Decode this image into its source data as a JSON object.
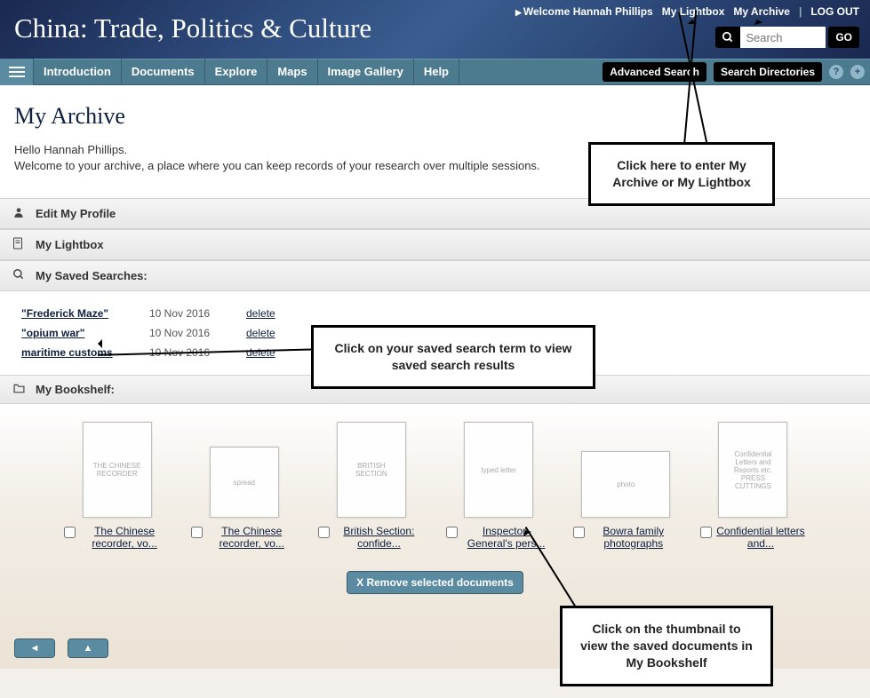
{
  "banner": {
    "title": "China: Trade, Politics & Culture",
    "welcome": "Welcome Hannah Phillips",
    "my_lightbox": "My Lightbox",
    "my_archive": "My Archive",
    "logout": "LOG OUT",
    "search_placeholder": "Search",
    "go": "GO"
  },
  "nav": {
    "items": [
      "Introduction",
      "Documents",
      "Explore",
      "Maps",
      "Image Gallery",
      "Help"
    ],
    "advanced": "Advanced Search",
    "directories": "Search Directories"
  },
  "page": {
    "title": "My Archive",
    "greeting": "Hello Hannah Phillips.",
    "intro": "Welcome to your archive, a place where you can keep records of your research over multiple sessions."
  },
  "sections": {
    "edit_profile": "Edit My Profile",
    "my_lightbox": "My Lightbox",
    "saved_searches": "My Saved Searches:",
    "bookshelf": "My Bookshelf:"
  },
  "saved_searches": [
    {
      "term": "\"Frederick Maze\"",
      "date": "10 Nov 2016",
      "delete": "delete"
    },
    {
      "term": "\"opium war\"",
      "date": "10 Nov 2016",
      "delete": "delete"
    },
    {
      "term": "maritime customs",
      "date": "10 Nov 2016",
      "delete": "delete"
    }
  ],
  "bookshelf": {
    "items": [
      {
        "label": "The Chinese recorder, vo...",
        "wide": false
      },
      {
        "label": "The Chinese recorder, vo...",
        "wide": false
      },
      {
        "label": "British Section: confide...",
        "wide": false
      },
      {
        "label": "Inspector-General's pers...",
        "wide": false
      },
      {
        "label": "Bowra family photographs",
        "wide": true
      },
      {
        "label": "Confidential letters and...",
        "wide": false
      }
    ],
    "remove": "X Remove selected documents"
  },
  "callouts": {
    "c1": "Click here to enter My Archive or My Lightbox",
    "c2": "Click on your saved search term to view saved search results",
    "c3": "Click on the thumbnail to view the saved documents in My Bookshelf"
  }
}
